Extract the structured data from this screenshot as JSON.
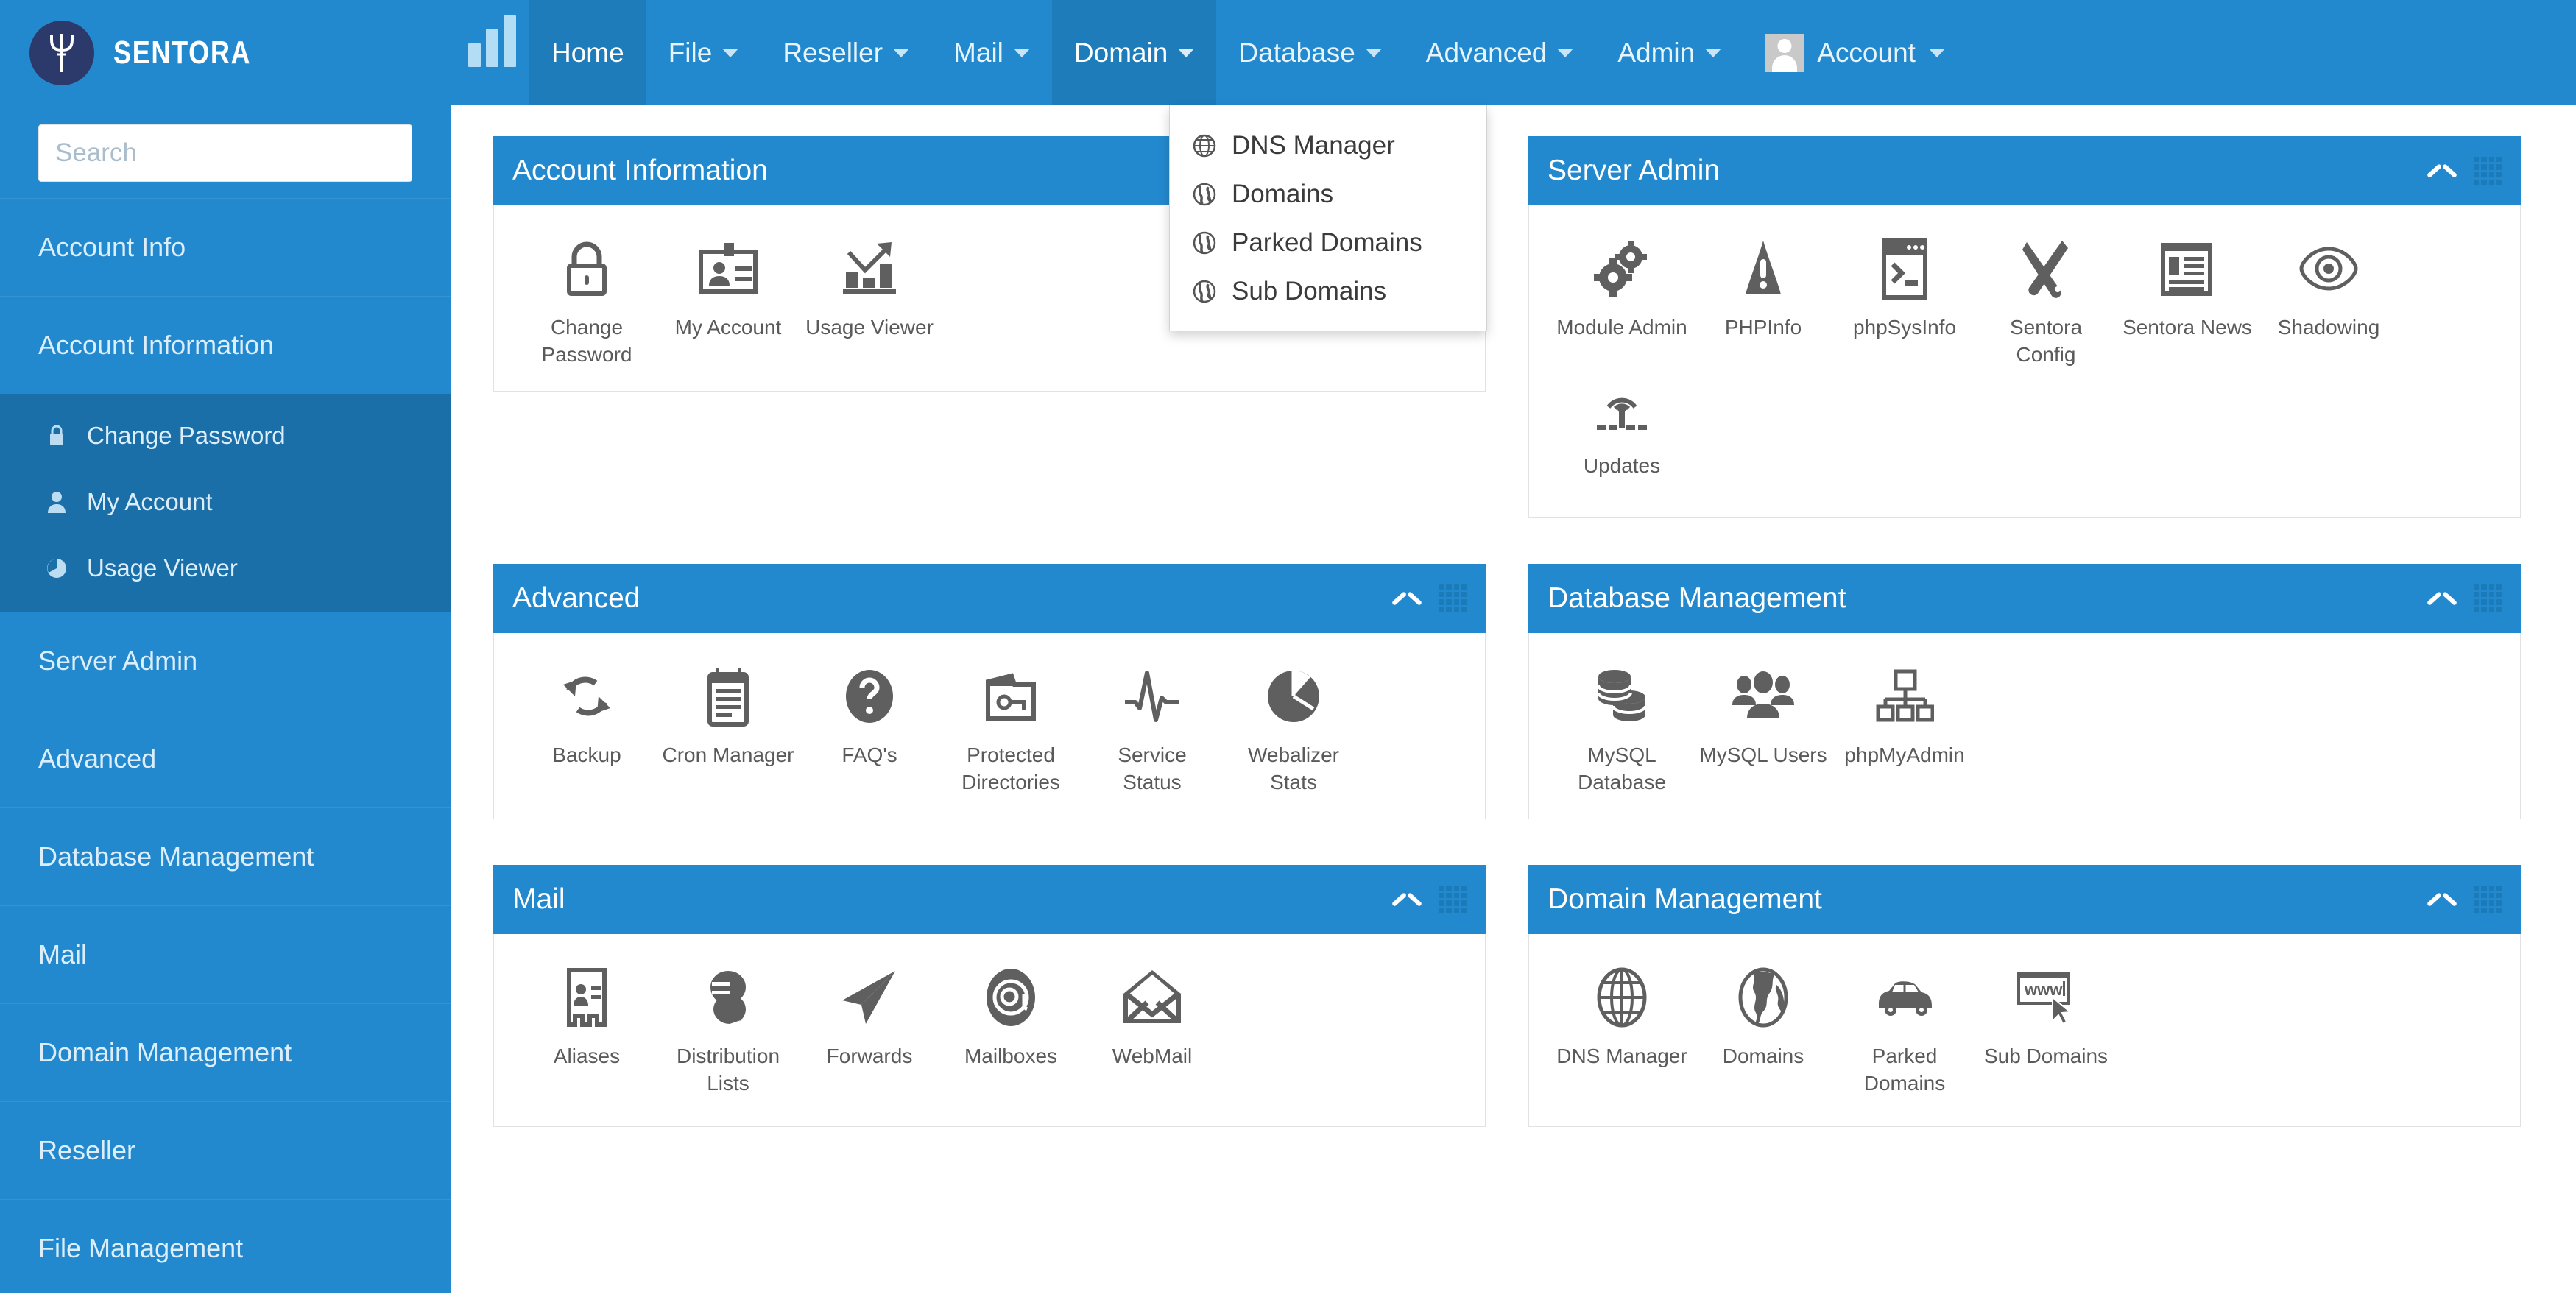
{
  "brand": {
    "name": "SENTORA",
    "logo_icon": "trident-logo-icon"
  },
  "topnav": {
    "chart_icon": "bar-chart-icon",
    "items": [
      {
        "label": "Home",
        "has_caret": false,
        "active": true
      },
      {
        "label": "File",
        "has_caret": true,
        "active": false
      },
      {
        "label": "Reseller",
        "has_caret": true,
        "active": false
      },
      {
        "label": "Mail",
        "has_caret": true,
        "active": false
      },
      {
        "label": "Domain",
        "has_caret": true,
        "active": true
      },
      {
        "label": "Database",
        "has_caret": true,
        "active": false
      },
      {
        "label": "Advanced",
        "has_caret": true,
        "active": false
      },
      {
        "label": "Admin",
        "has_caret": true,
        "active": false
      }
    ],
    "account": {
      "label": "Account",
      "avatar_icon": "user-avatar-icon"
    }
  },
  "domain_dropdown": {
    "open": true,
    "items": [
      {
        "label": "DNS Manager",
        "icon": "globe-wire-icon"
      },
      {
        "label": "Domains",
        "icon": "globe-icon"
      },
      {
        "label": "Parked Domains",
        "icon": "globe-icon"
      },
      {
        "label": "Sub Domains",
        "icon": "globe-icon"
      }
    ]
  },
  "sidebar": {
    "search": {
      "placeholder": "Search",
      "value": ""
    },
    "items": [
      {
        "label": "Account Info"
      },
      {
        "label": "Account Information"
      },
      {
        "label": "Server Admin"
      },
      {
        "label": "Advanced"
      },
      {
        "label": "Database Management"
      },
      {
        "label": "Mail"
      },
      {
        "label": "Domain Management"
      },
      {
        "label": "Reseller"
      },
      {
        "label": "File Management"
      }
    ],
    "expanded_sub_items": [
      {
        "label": "Change Password",
        "icon": "lock-icon"
      },
      {
        "label": "My Account",
        "icon": "user-icon"
      },
      {
        "label": "Usage Viewer",
        "icon": "pie-chart-icon"
      }
    ]
  },
  "panels": [
    {
      "title": "Account Information",
      "collapse_icon": "chevron-up-icon",
      "drag_icon": "drag-handle-icon",
      "tiles": [
        {
          "label": "Change Password",
          "icon": "padlock-icon"
        },
        {
          "label": "My Account",
          "icon": "id-card-icon"
        },
        {
          "label": "Usage Viewer",
          "icon": "growth-chart-icon"
        }
      ]
    },
    {
      "title": "Server Admin",
      "collapse_icon": "chevron-up-icon",
      "drag_icon": "drag-handle-icon",
      "tiles": [
        {
          "label": "Module Admin",
          "icon": "gears-icon"
        },
        {
          "label": "PHPInfo",
          "icon": "warning-triangle-icon"
        },
        {
          "label": "phpSysInfo",
          "icon": "terminal-window-icon"
        },
        {
          "label": "Sentora Config",
          "icon": "tools-icon"
        },
        {
          "label": "Sentora News",
          "icon": "newspaper-icon"
        },
        {
          "label": "Shadowing",
          "icon": "eye-icon"
        },
        {
          "label": "Updates",
          "icon": "broadcast-icon"
        }
      ]
    },
    {
      "title": "Advanced",
      "collapse_icon": "chevron-up-icon",
      "drag_icon": "drag-handle-icon",
      "tiles": [
        {
          "label": "Backup",
          "icon": "refresh-arrows-icon"
        },
        {
          "label": "Cron Manager",
          "icon": "calendar-icon"
        },
        {
          "label": "FAQ's",
          "icon": "question-mark-icon"
        },
        {
          "label": "Protected Directories",
          "icon": "folder-key-icon"
        },
        {
          "label": "Service Status",
          "icon": "pulse-icon"
        },
        {
          "label": "Webalizer Stats",
          "icon": "pie-chart-icon"
        }
      ]
    },
    {
      "title": "Database Management",
      "collapse_icon": "chevron-up-icon",
      "drag_icon": "drag-handle-icon",
      "tiles": [
        {
          "label": "MySQL Database",
          "icon": "database-icon"
        },
        {
          "label": "MySQL Users",
          "icon": "users-group-icon"
        },
        {
          "label": "phpMyAdmin",
          "icon": "sitemap-icon"
        }
      ]
    },
    {
      "title": "Mail",
      "collapse_icon": "chevron-up-icon",
      "drag_icon": "drag-handle-icon",
      "tiles": [
        {
          "label": "Aliases",
          "icon": "contact-card-icon"
        },
        {
          "label": "Distribution Lists",
          "icon": "speech-bubbles-icon"
        },
        {
          "label": "Forwards",
          "icon": "paper-plane-icon"
        },
        {
          "label": "Mailboxes",
          "icon": "at-sign-icon"
        },
        {
          "label": "WebMail",
          "icon": "open-envelope-icon"
        }
      ]
    },
    {
      "title": "Domain Management",
      "collapse_icon": "chevron-up-icon",
      "drag_icon": "drag-handle-icon",
      "tiles": [
        {
          "label": "DNS Manager",
          "icon": "globe-wire-icon"
        },
        {
          "label": "Domains",
          "icon": "globe-filled-icon"
        },
        {
          "label": "Parked Domains",
          "icon": "car-icon"
        },
        {
          "label": "Sub Domains",
          "icon": "www-bar-icon"
        }
      ]
    }
  ],
  "colors": {
    "brand_blue": "#2389ce",
    "active_blue": "#1e7cbb",
    "submenu_blue": "#1b6fa8",
    "logo_navy": "#2b3a6b",
    "icon_gray": "#5f5f5f",
    "label_gray": "#5a5a5a"
  }
}
